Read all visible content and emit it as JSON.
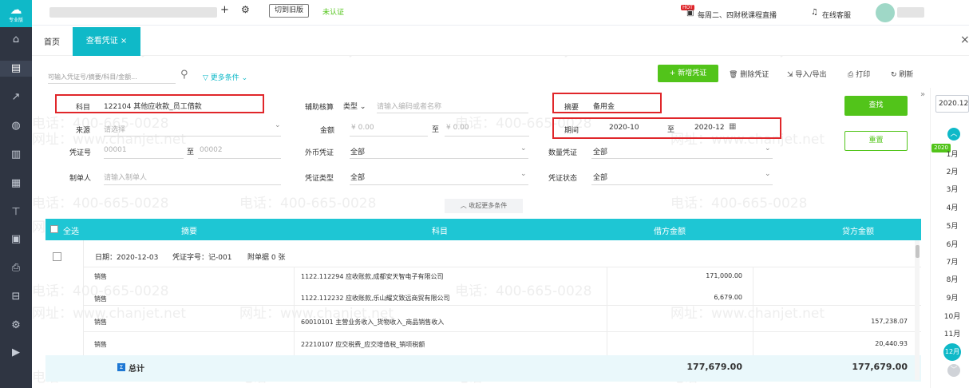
{
  "brand": {
    "label": "专业版"
  },
  "topbar": {
    "switch_label": "切到旧版",
    "auth_status": "未认证",
    "hot_badge": "HOT",
    "live_label": "每周二、四财税课程直播",
    "service_label": "在线客服"
  },
  "tabs": [
    {
      "label": "首页"
    },
    {
      "label": "查看凭证"
    }
  ],
  "search": {
    "placeholder": "可输入凭证号/摘要/科目/金额...",
    "more_label": "更多条件"
  },
  "toolbar": {
    "add_label": "+ 新增凭证",
    "delete_label": "删除凭证",
    "import_label": "导入/导出",
    "print_label": "打印",
    "refresh_label": "刷新"
  },
  "filters": {
    "account_label": "科目",
    "account_value": "122104 其他应收款_员工借款",
    "aux_label": "辅助核算",
    "aux_type": "类型",
    "aux_placeholder": "请输入编码或者名称",
    "summary_label": "摘要",
    "summary_value": "备用金",
    "source_label": "来源",
    "source_placeholder": "请选择",
    "amount_label": "金额",
    "amount_from": "¥ 0.00",
    "amount_to_label": "至",
    "amount_to": "¥ 0.00",
    "period_label": "期间",
    "period_from": "2020-10",
    "period_to_label": "至",
    "period_to": "2020-12",
    "voucher_no_label": "凭证号",
    "voucher_no_from": "00001",
    "voucher_no_to_label": "至",
    "voucher_no_to": "00002",
    "fx_label": "外币凭证",
    "fx_value": "全部",
    "qty_label": "数量凭证",
    "qty_value": "全部",
    "maker_label": "制单人",
    "maker_placeholder": "请输入制单人",
    "vtype_label": "凭证类型",
    "vtype_value": "全部",
    "vstatus_label": "凭证状态",
    "vstatus_value": "全部",
    "search_btn": "查找",
    "reset_btn": "重置",
    "collapse_label": "收起更多条件"
  },
  "table": {
    "headers": {
      "select_all": "全选",
      "summary": "摘要",
      "account": "科目",
      "debit": "借方金额",
      "credit": "贷方金额"
    },
    "voucher": {
      "date": "日期：2020-12-03",
      "number": "凭证字号：记-001",
      "attachments": "附单据 0 张"
    },
    "rows": [
      {
        "summary": "销售",
        "account": "1122.112294 应收账款,成都安天智电子有限公司",
        "debit": "171,000.00",
        "credit": ""
      },
      {
        "summary": "销售",
        "account": "1122.112232 应收账款,乐山耀文致远商贸有限公司",
        "debit": "6,679.00",
        "credit": ""
      },
      {
        "summary": "销售",
        "account": "60010101 主营业务收入_货物收入_商品销售收入",
        "debit": "",
        "credit": "157,238.07"
      },
      {
        "summary": "销售",
        "account": "22210107 应交税费_应交增值税_销项税额",
        "debit": "",
        "credit": "20,440.93"
      }
    ],
    "total": {
      "label": "总计",
      "debit": "177,679.00",
      "credit": "177,679.00"
    }
  },
  "date_panel": {
    "year_input": "2020.12",
    "year_badge": "2020",
    "months": [
      "1月",
      "2月",
      "3月",
      "4月",
      "5月",
      "6月",
      "7月",
      "8月",
      "9月",
      "10月",
      "11月",
      "12月"
    ]
  },
  "watermark": {
    "phone": "电话：400-665-0028",
    "site": "网址：www.chanjet.net"
  },
  "colors": {
    "accent": "#0fb9c8",
    "primary_green": "#52c41a",
    "highlight_red": "#e0262a",
    "rail_bg": "#2f3542"
  }
}
